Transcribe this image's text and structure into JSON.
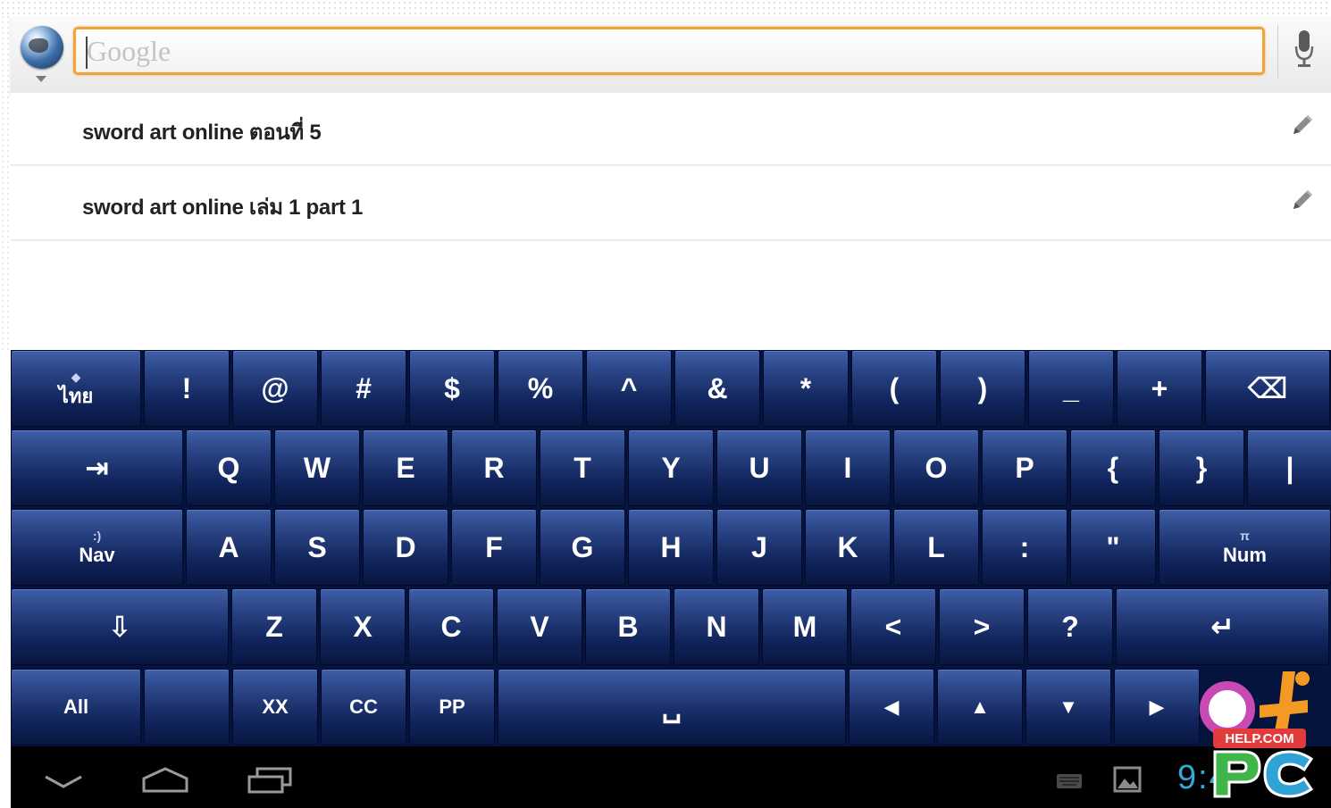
{
  "search": {
    "placeholder": "Google",
    "value": ""
  },
  "suggestions": [
    {
      "text": "sword art online ตอนที่ 5"
    },
    {
      "text": "sword art online เล่ม 1 part 1"
    }
  ],
  "keyboard": {
    "rows": [
      [
        {
          "name": "key-thai-lang",
          "top": "◆",
          "label": "ไทย",
          "type": "dual"
        },
        {
          "name": "key-exclamation",
          "label": "!"
        },
        {
          "name": "key-at",
          "label": "@"
        },
        {
          "name": "key-hash",
          "label": "#"
        },
        {
          "name": "key-dollar",
          "label": "$"
        },
        {
          "name": "key-percent",
          "label": "%"
        },
        {
          "name": "key-caret",
          "label": "^"
        },
        {
          "name": "key-ampersand",
          "label": "&"
        },
        {
          "name": "key-asterisk",
          "label": "*"
        },
        {
          "name": "key-open-paren",
          "label": "("
        },
        {
          "name": "key-close-paren",
          "label": ")"
        },
        {
          "name": "key-underscore",
          "label": "_"
        },
        {
          "name": "key-plus",
          "label": "+"
        },
        {
          "name": "key-backspace",
          "label": "⌫",
          "icon": "backspace-icon"
        }
      ],
      [
        {
          "name": "key-tab",
          "label": "⇥",
          "icon": "tab-icon"
        },
        {
          "name": "key-q",
          "label": "Q"
        },
        {
          "name": "key-w",
          "label": "W"
        },
        {
          "name": "key-e",
          "label": "E"
        },
        {
          "name": "key-r",
          "label": "R"
        },
        {
          "name": "key-t",
          "label": "T"
        },
        {
          "name": "key-y",
          "label": "Y"
        },
        {
          "name": "key-u",
          "label": "U"
        },
        {
          "name": "key-i",
          "label": "I"
        },
        {
          "name": "key-o",
          "label": "O"
        },
        {
          "name": "key-p",
          "label": "P"
        },
        {
          "name": "key-open-brace",
          "label": "{"
        },
        {
          "name": "key-close-brace",
          "label": "}"
        },
        {
          "name": "key-pipe",
          "label": "|"
        }
      ],
      [
        {
          "name": "key-nav",
          "top": ":)",
          "label": "Nav",
          "type": "dual"
        },
        {
          "name": "key-a",
          "label": "A"
        },
        {
          "name": "key-s",
          "label": "S"
        },
        {
          "name": "key-d",
          "label": "D"
        },
        {
          "name": "key-f",
          "label": "F"
        },
        {
          "name": "key-g",
          "label": "G"
        },
        {
          "name": "key-h",
          "label": "H"
        },
        {
          "name": "key-j",
          "label": "J"
        },
        {
          "name": "key-k",
          "label": "K"
        },
        {
          "name": "key-l",
          "label": "L"
        },
        {
          "name": "key-colon",
          "label": ":"
        },
        {
          "name": "key-quote",
          "label": "\""
        },
        {
          "name": "key-num",
          "top": "π",
          "label": "Num",
          "type": "dual"
        }
      ],
      [
        {
          "name": "key-shift",
          "label": "⇩",
          "icon": "shift-icon"
        },
        {
          "name": "key-z",
          "label": "Z"
        },
        {
          "name": "key-x",
          "label": "X"
        },
        {
          "name": "key-c",
          "label": "C"
        },
        {
          "name": "key-v",
          "label": "V"
        },
        {
          "name": "key-b",
          "label": "B"
        },
        {
          "name": "key-n",
          "label": "N"
        },
        {
          "name": "key-m",
          "label": "M"
        },
        {
          "name": "key-less-than",
          "label": "<"
        },
        {
          "name": "key-greater-than",
          "label": ">"
        },
        {
          "name": "key-question",
          "label": "?"
        },
        {
          "name": "key-enter",
          "label": "↵",
          "icon": "enter-icon"
        }
      ],
      [
        {
          "name": "key-all",
          "label": "All",
          "type": "fn"
        },
        {
          "name": "key-blank",
          "label": "",
          "type": "fn"
        },
        {
          "name": "key-xx",
          "label": "XX",
          "type": "fn"
        },
        {
          "name": "key-cc",
          "label": "CC",
          "type": "fn"
        },
        {
          "name": "key-pp",
          "label": "PP",
          "type": "fn"
        },
        {
          "name": "key-space",
          "label": "␣",
          "icon": "space-icon"
        },
        {
          "name": "key-arrow-left",
          "label": "◀",
          "icon": "arrow-left-icon",
          "type": "fn"
        },
        {
          "name": "key-arrow-up",
          "label": "▲",
          "icon": "arrow-up-icon",
          "type": "fn"
        },
        {
          "name": "key-arrow-down",
          "label": "▼",
          "icon": "arrow-down-icon",
          "type": "fn"
        },
        {
          "name": "key-arrow-right",
          "label": "▶",
          "icon": "arrow-right-icon",
          "type": "fn"
        }
      ]
    ]
  },
  "statusbar": {
    "clock": "9:4"
  },
  "watermark": {
    "text": "HELP.COM PC"
  },
  "colors": {
    "accent": "#f2a33c",
    "key_top": "#3f5fa8",
    "key_bottom": "#081640",
    "clock": "#35a8d8"
  }
}
